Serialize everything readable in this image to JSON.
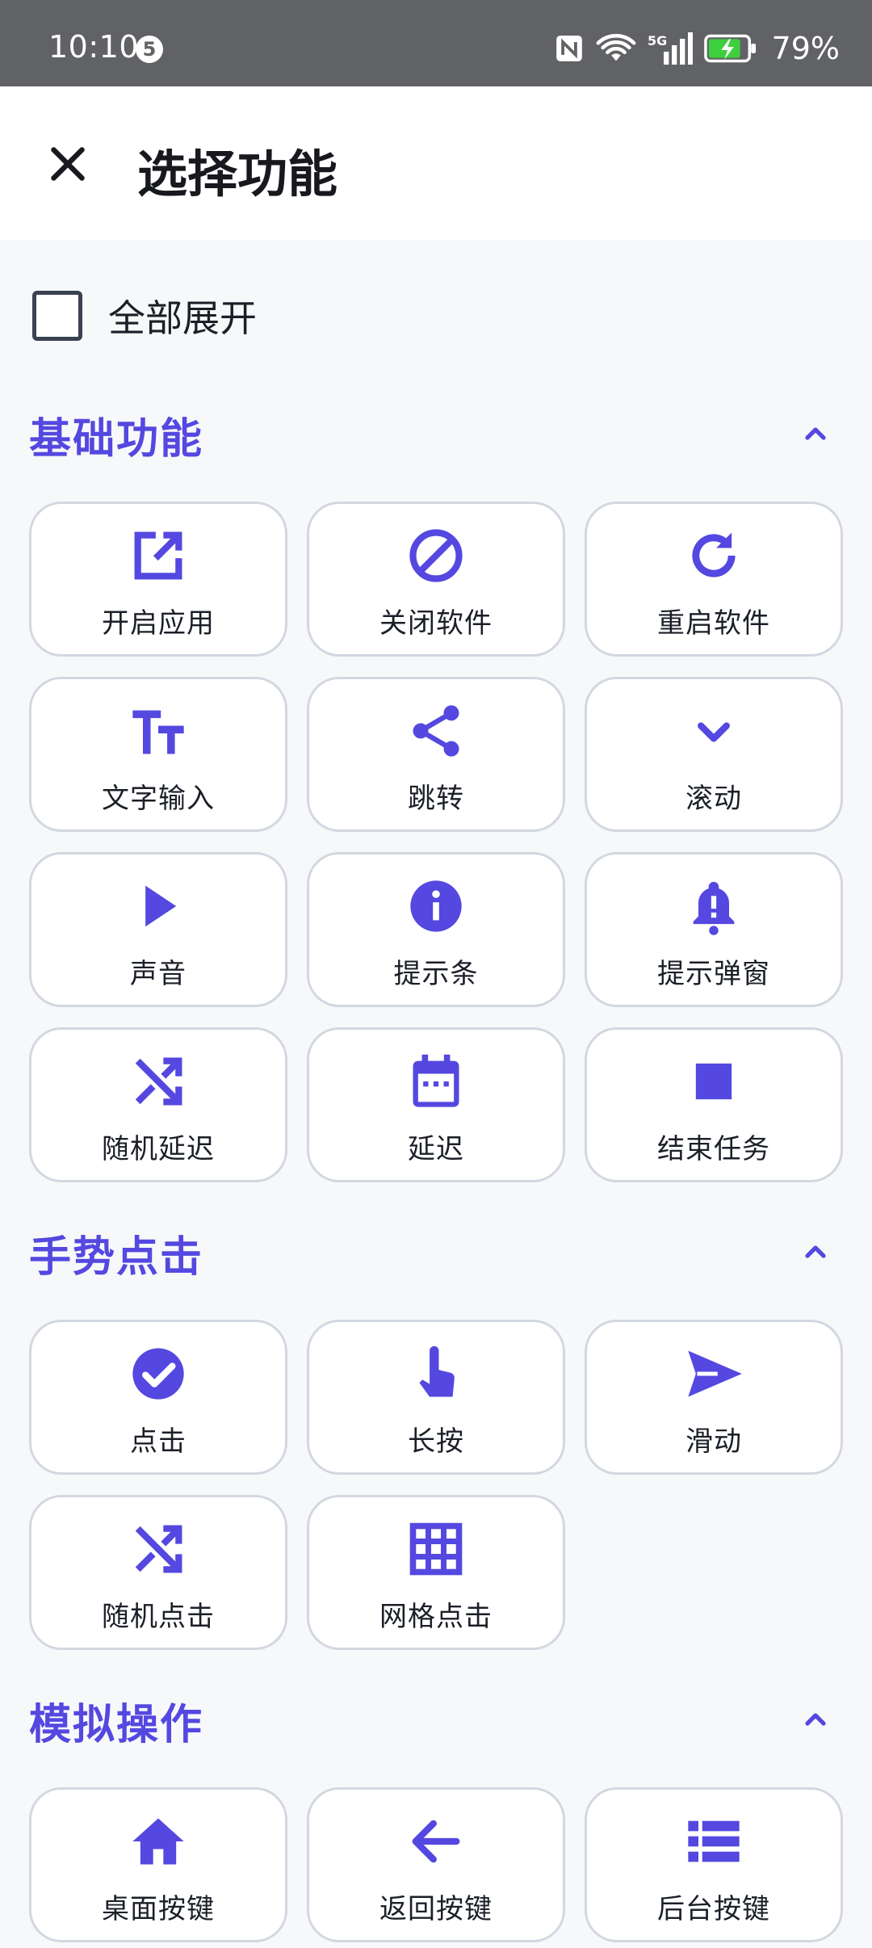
{
  "status_bar": {
    "time": "10:10",
    "notification_count": "5",
    "battery": "79%"
  },
  "header": {
    "title": "选择功能"
  },
  "expand_all": {
    "label": "全部展开"
  },
  "sections": [
    {
      "title": "基础功能",
      "items": [
        {
          "label": "开启应用",
          "icon": "open-external-icon"
        },
        {
          "label": "关闭软件",
          "icon": "block-icon"
        },
        {
          "label": "重启软件",
          "icon": "refresh-icon"
        },
        {
          "label": "文字输入",
          "icon": "text-size-icon"
        },
        {
          "label": "跳转",
          "icon": "share-icon"
        },
        {
          "label": "滚动",
          "icon": "chevron-down-icon"
        },
        {
          "label": "声音",
          "icon": "play-icon"
        },
        {
          "label": "提示条",
          "icon": "info-icon"
        },
        {
          "label": "提示弹窗",
          "icon": "bell-alert-icon"
        },
        {
          "label": "随机延迟",
          "icon": "shuffle-icon"
        },
        {
          "label": "延迟",
          "icon": "calendar-icon"
        },
        {
          "label": "结束任务",
          "icon": "stop-icon"
        }
      ]
    },
    {
      "title": "手势点击",
      "items": [
        {
          "label": "点击",
          "icon": "check-circle-icon"
        },
        {
          "label": "长按",
          "icon": "touch-hand-icon"
        },
        {
          "label": "滑动",
          "icon": "send-icon"
        },
        {
          "label": "随机点击",
          "icon": "shuffle-icon"
        },
        {
          "label": "网格点击",
          "icon": "grid-icon"
        }
      ]
    },
    {
      "title": "模拟操作",
      "items": [
        {
          "label": "桌面按键",
          "icon": "home-icon"
        },
        {
          "label": "返回按键",
          "icon": "arrow-left-icon"
        },
        {
          "label": "后台按键",
          "icon": "list-view-icon"
        }
      ]
    }
  ],
  "colors": {
    "accent": "#5448e0",
    "status_bar": "#616265",
    "tile_border": "#d3d7e0",
    "background": "#f7f8fa"
  }
}
